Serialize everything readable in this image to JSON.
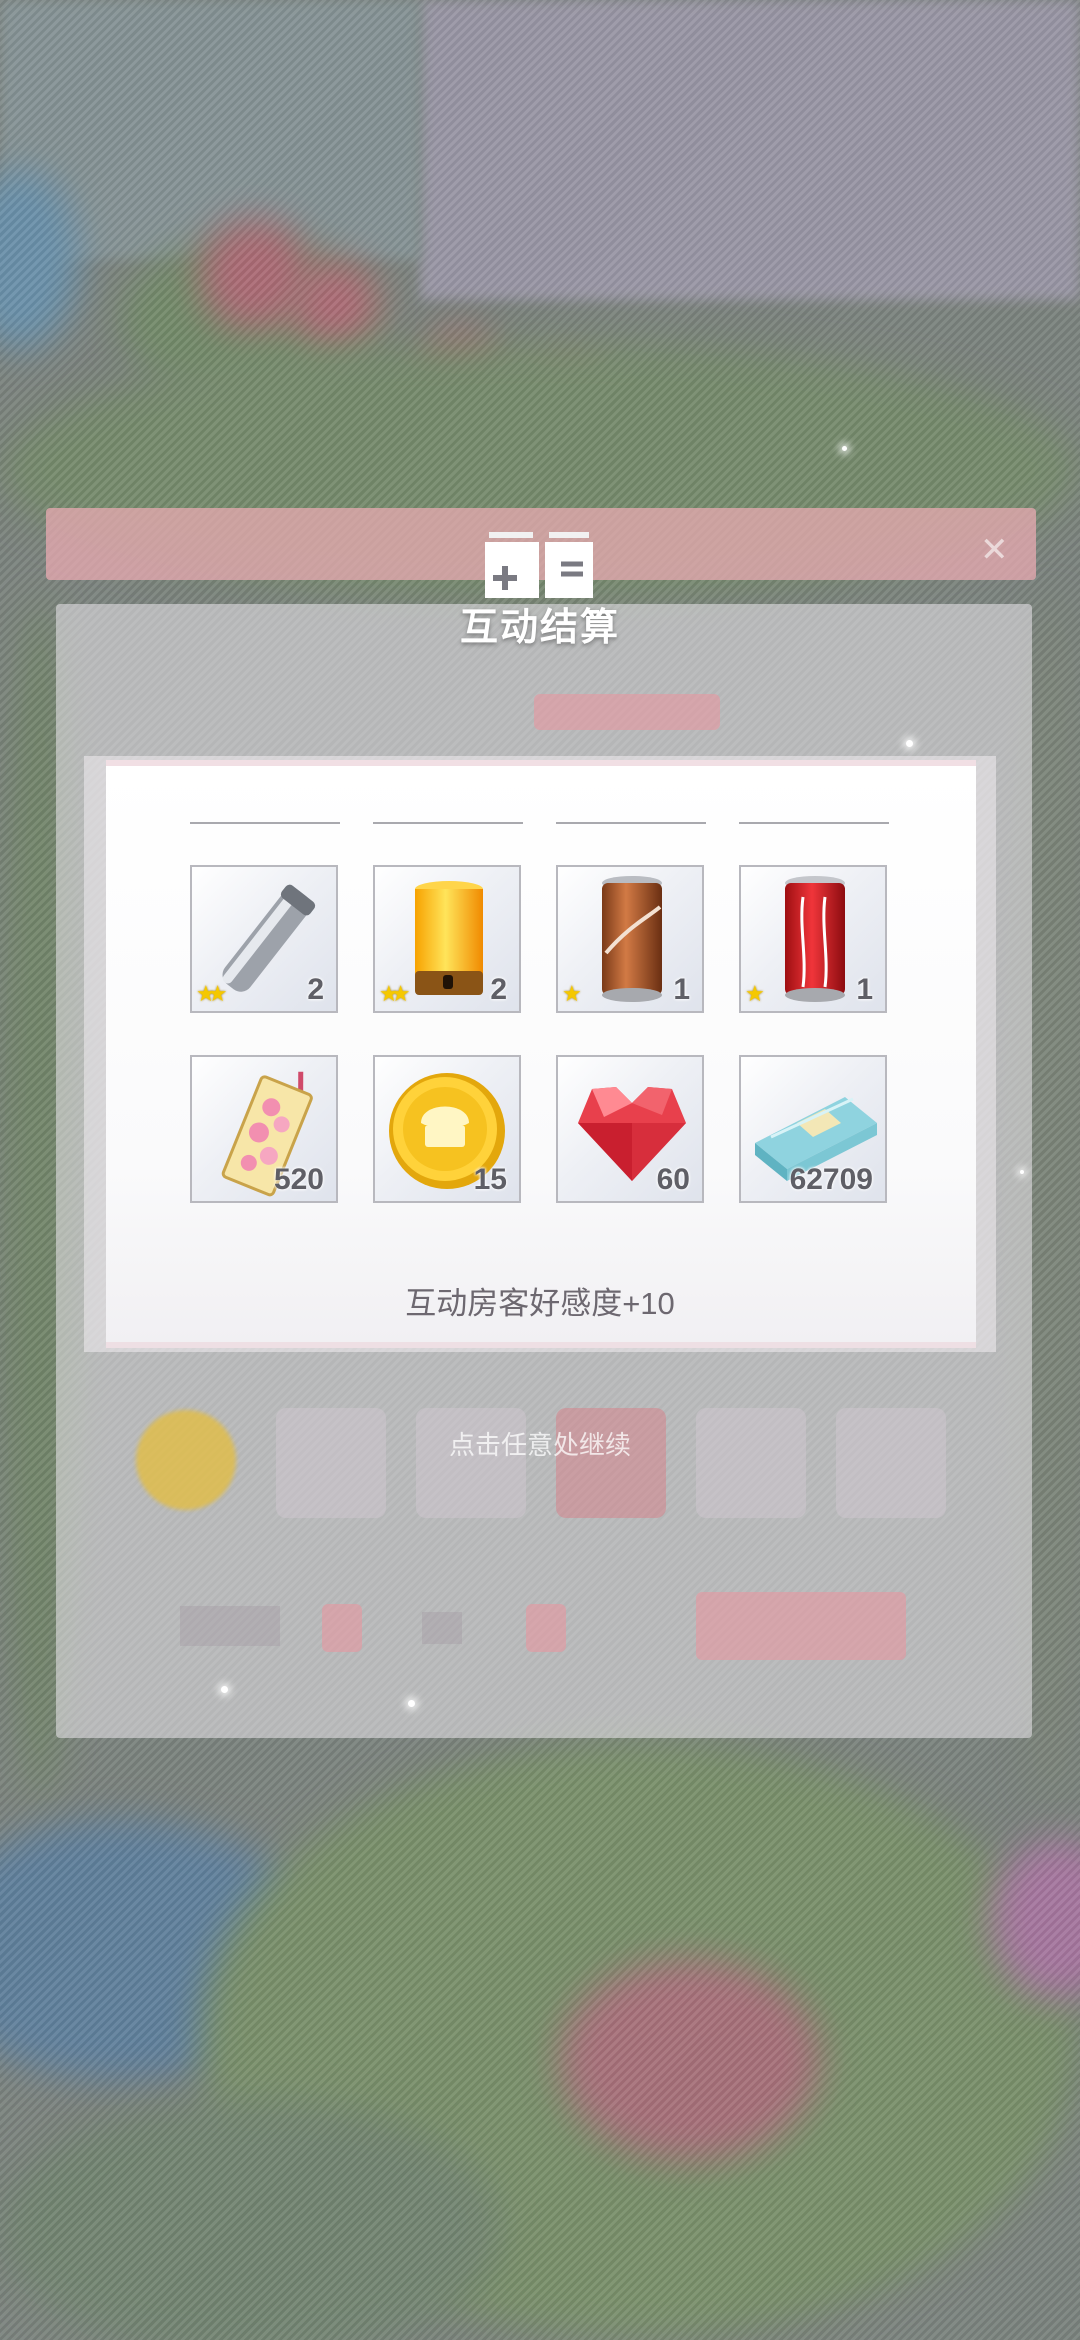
{
  "popup": {
    "title": "互动结算",
    "bonus_text": "互动房客好感度+10",
    "continue_hint": "点击任意处继续"
  },
  "rewards": [
    {
      "icon": "silver-thermos-icon",
      "count": "2",
      "stars": "★★"
    },
    {
      "icon": "yellow-lamp-icon",
      "count": "2",
      "stars": "★★"
    },
    {
      "icon": "coffee-can-icon",
      "count": "1",
      "stars": "★"
    },
    {
      "icon": "coca-cola-can-icon",
      "count": "1",
      "stars": "★"
    },
    {
      "icon": "sakura-charm-icon",
      "count": "520",
      "stars": ""
    },
    {
      "icon": "gold-coin-icon",
      "count": "15",
      "stars": ""
    },
    {
      "icon": "red-heart-gem-icon",
      "count": "60",
      "stars": ""
    },
    {
      "icon": "cash-bundle-icon",
      "count": "62709",
      "stars": ""
    }
  ],
  "colors": {
    "popup_border": "#f1dfe4",
    "overlay": "#787882",
    "coin": "#f2c230",
    "heart": "#e8404c"
  }
}
